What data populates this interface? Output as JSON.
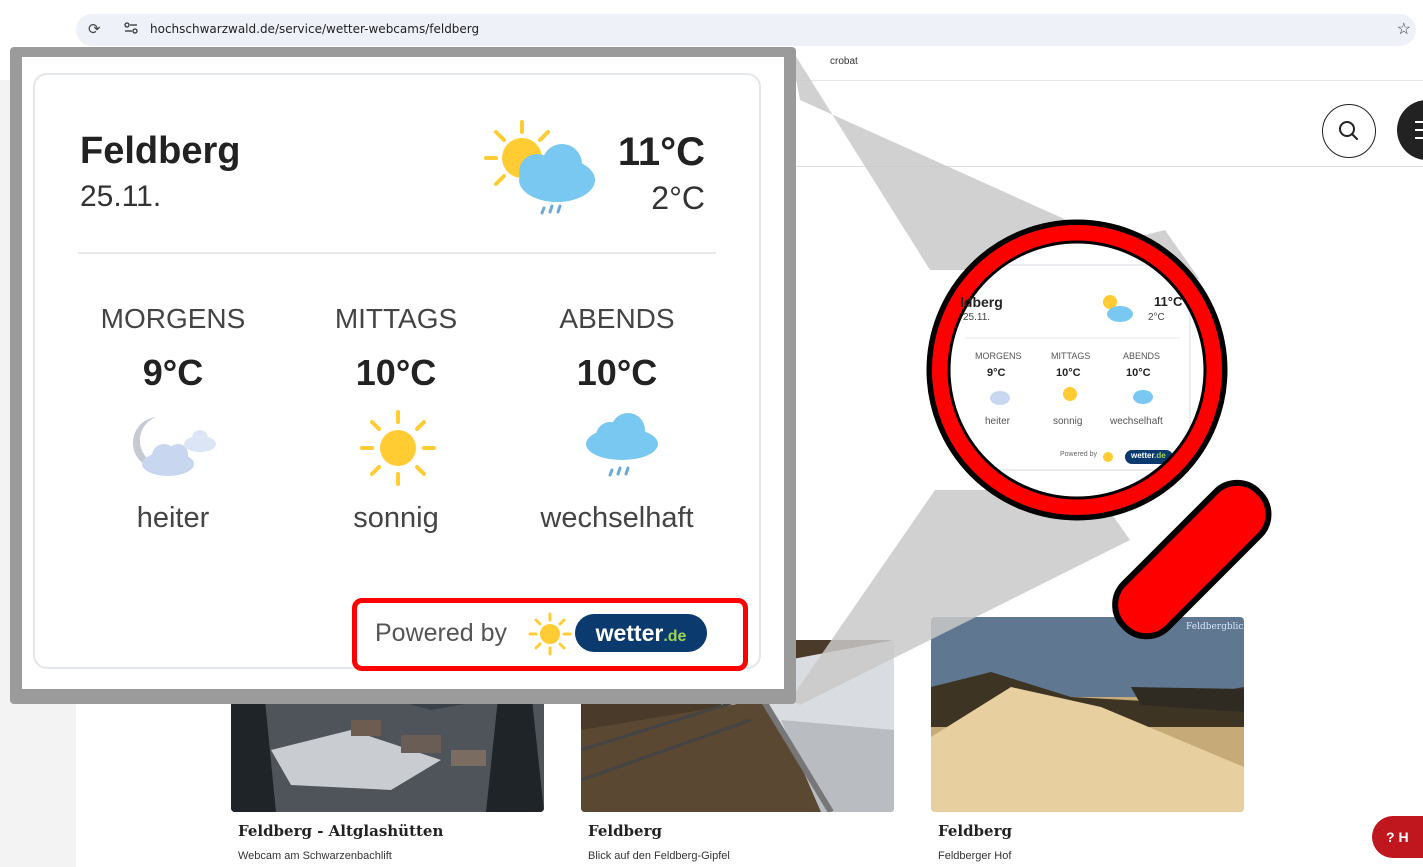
{
  "browser": {
    "url": "hochschwarzwald.de/service/wetter-webcams/feldberg",
    "bookmark_fragment": "crobat",
    "reload_icon": "⟳",
    "site_info_icon": "⚙",
    "star_icon": "☆"
  },
  "weather_card": {
    "location": "Feldberg",
    "date": "25.11.",
    "max_temp": "11°C",
    "min_temp": "2°C",
    "periods": [
      {
        "label": "MORGENS",
        "temp": "9°C",
        "description": "heiter",
        "icon": "moon-cloud-icon"
      },
      {
        "label": "MITTAGS",
        "temp": "10°C",
        "description": "sonnig",
        "icon": "sun-icon"
      },
      {
        "label": "ABENDS",
        "temp": "10°C",
        "description": "wechselhaft",
        "icon": "rain-cloud-icon"
      }
    ],
    "powered_by": "Powered by",
    "brand": "wetter",
    "brand_suffix": ".de"
  },
  "mini_card": {
    "location_fragment": "ldberg",
    "date_fragment": "25.11.",
    "max_temp": "11°C",
    "min_temp": "2°C",
    "periods": [
      {
        "label": "MORGENS",
        "temp": "9°C",
        "description": "heiter"
      },
      {
        "label": "MITTAGS",
        "temp": "10°C",
        "description": "sonnig"
      },
      {
        "label": "ABENDS",
        "temp": "10°C",
        "description": "wechselhaft"
      }
    ],
    "powered_by": "Powered by",
    "brand": "wetter",
    "brand_suffix": ".de"
  },
  "webcams": [
    {
      "title": "Feldberg - Altglashütten",
      "subtitle": "Webcam am Schwarzenbachlift"
    },
    {
      "title": "Feldberg",
      "subtitle": "Blick auf den Feldberg-Gipfel"
    },
    {
      "title": "Feldberg",
      "subtitle": "Feldberger Hof"
    }
  ],
  "help_button": {
    "label": "H",
    "icon": "question-circle-icon"
  },
  "colors": {
    "highlight_red": "#ff0000",
    "brand_navy": "#0b3b6e",
    "help_red": "#c0161e"
  }
}
